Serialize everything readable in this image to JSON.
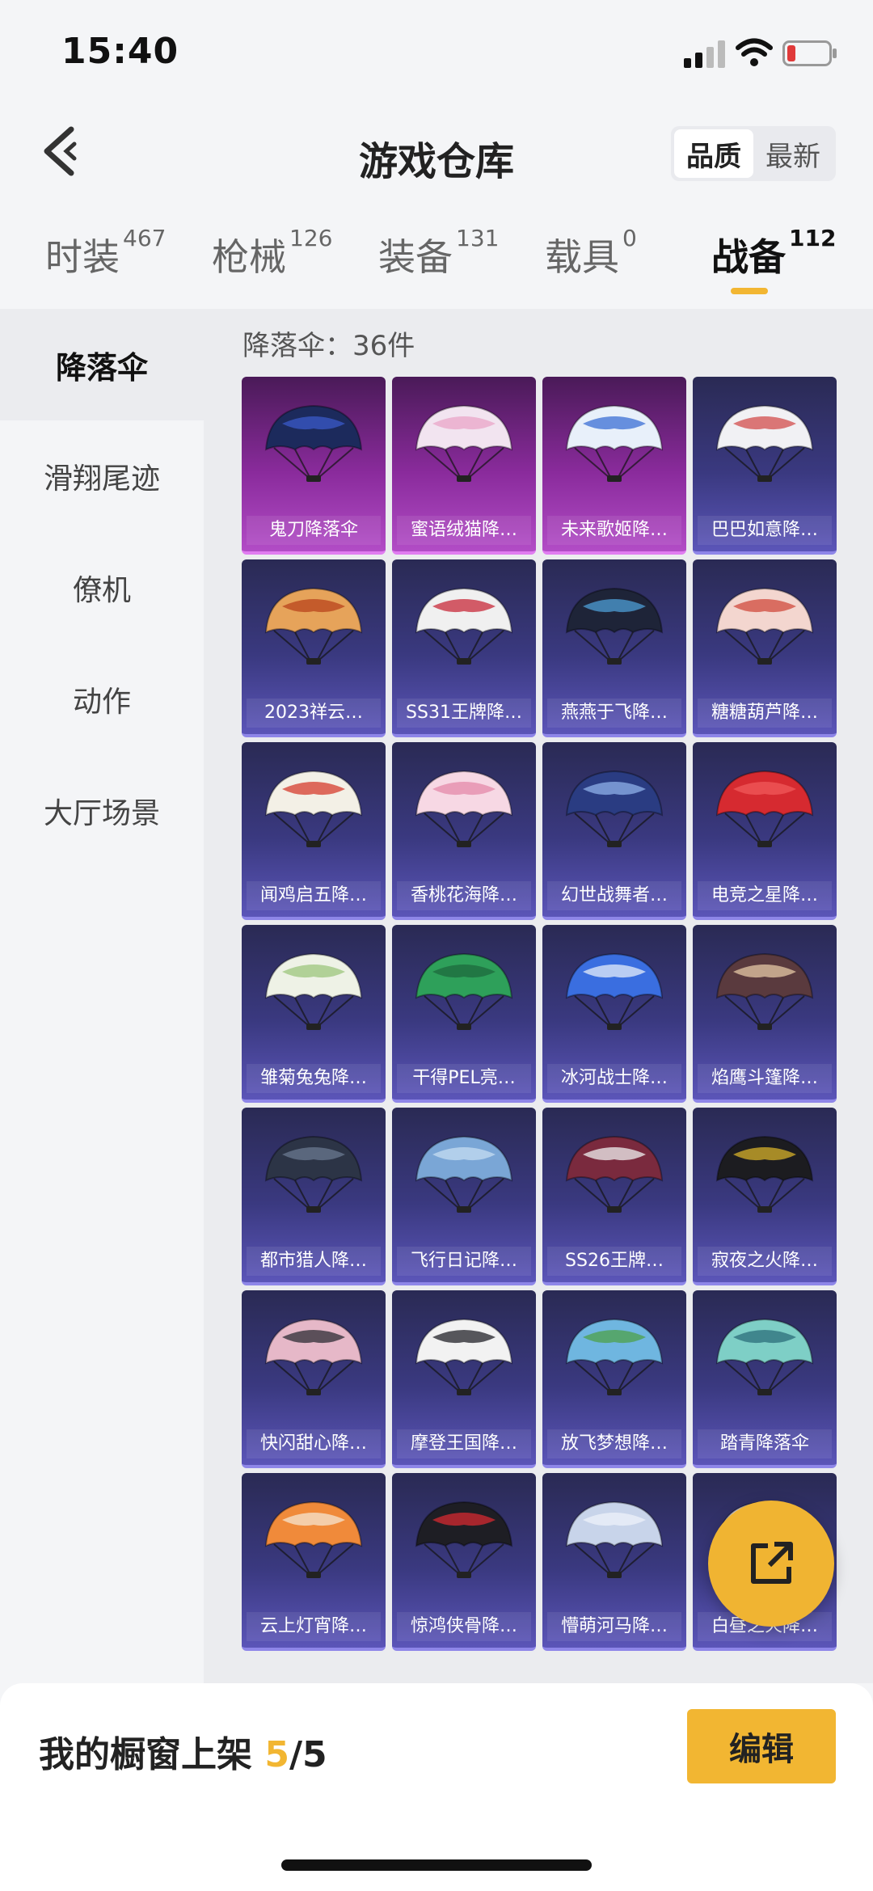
{
  "status_bar": {
    "time": "15:40"
  },
  "header": {
    "title": "游戏仓库",
    "sort_quality": "品质",
    "sort_newest": "最新"
  },
  "tabs": [
    {
      "label": "时装",
      "count": "467"
    },
    {
      "label": "枪械",
      "count": "126"
    },
    {
      "label": "装备",
      "count": "131"
    },
    {
      "label": "载具",
      "count": "0"
    },
    {
      "label": "战备",
      "count": "112"
    }
  ],
  "sidebar": [
    {
      "label": "降落伞"
    },
    {
      "label": "滑翔尾迹"
    },
    {
      "label": "僚机"
    },
    {
      "label": "动作"
    },
    {
      "label": "大厅场景"
    }
  ],
  "content": {
    "count_label": "降落伞：36件"
  },
  "items": [
    {
      "name": "鬼刀降落伞",
      "rarity": "purple",
      "colors": [
        "#1c2a5c",
        "#3a5ac8"
      ]
    },
    {
      "name": "蜜语绒猫降…",
      "rarity": "purple",
      "colors": [
        "#f2e4f0",
        "#e9a6c8"
      ]
    },
    {
      "name": "未来歌姬降…",
      "rarity": "purple",
      "colors": [
        "#e8f0fa",
        "#3b6fd4"
      ]
    },
    {
      "name": "巴巴如意降…",
      "rarity": "blue",
      "colors": [
        "#f1f1f4",
        "#d14c4c"
      ]
    },
    {
      "name": "2023祥云…",
      "rarity": "blue",
      "colors": [
        "#e6a35a",
        "#b8431c"
      ]
    },
    {
      "name": "SS31王牌降…",
      "rarity": "blue",
      "colors": [
        "#f0f0f0",
        "#c82a3a"
      ]
    },
    {
      "name": "燕燕于飞降…",
      "rarity": "blue",
      "colors": [
        "#1e2438",
        "#4e9ed6"
      ]
    },
    {
      "name": "糖糖葫芦降…",
      "rarity": "blue",
      "colors": [
        "#f3d6cf",
        "#d04a3c"
      ]
    },
    {
      "name": "闻鸡启五降…",
      "rarity": "blue",
      "colors": [
        "#f3f0e6",
        "#d63c2c"
      ]
    },
    {
      "name": "香桃花海降…",
      "rarity": "blue",
      "colors": [
        "#f7d8e4",
        "#e48aaa"
      ]
    },
    {
      "name": "幻世战舞者…",
      "rarity": "blue",
      "colors": [
        "#2a3c82",
        "#8fb0e8"
      ]
    },
    {
      "name": "电竞之星降…",
      "rarity": "blue",
      "colors": [
        "#d62a30",
        "#f05a5a"
      ]
    },
    {
      "name": "雏菊兔兔降…",
      "rarity": "blue",
      "colors": [
        "#eef2e6",
        "#9cc57c"
      ]
    },
    {
      "name": "干得PEL亮…",
      "rarity": "blue",
      "colors": [
        "#2ea05a",
        "#1e6a3e"
      ]
    },
    {
      "name": "冰河战士降…",
      "rarity": "blue",
      "colors": [
        "#3a6ee0",
        "#e6eefa"
      ]
    },
    {
      "name": "焰鹰斗篷降…",
      "rarity": "blue",
      "colors": [
        "#5a3a3e",
        "#e6c8a6"
      ]
    },
    {
      "name": "都市猎人降…",
      "rarity": "blue",
      "colors": [
        "#2c3446",
        "#6a7890"
      ]
    },
    {
      "name": "飞行日记降…",
      "rarity": "blue",
      "colors": [
        "#7aa6d6",
        "#c6dcf2"
      ]
    },
    {
      "name": "SS26王牌…",
      "rarity": "blue",
      "colors": [
        "#7a2a3e",
        "#f0f0f0"
      ]
    },
    {
      "name": "寂夜之火降…",
      "rarity": "blue",
      "colors": [
        "#1c1c20",
        "#d6b02a"
      ]
    },
    {
      "name": "快闪甜心降…",
      "rarity": "blue",
      "colors": [
        "#e6b8c8",
        "#2c2c34"
      ]
    },
    {
      "name": "摩登王国降…",
      "rarity": "blue",
      "colors": [
        "#f2f2f2",
        "#222228"
      ]
    },
    {
      "name": "放飞梦想降…",
      "rarity": "blue",
      "colors": [
        "#6fb6e0",
        "#4ea04a"
      ]
    },
    {
      "name": "踏青降落伞",
      "rarity": "blue",
      "colors": [
        "#7ecfc6",
        "#2c6e7a"
      ]
    },
    {
      "name": "云上灯宵降…",
      "rarity": "blue",
      "colors": [
        "#f08a3a",
        "#f6e4d0"
      ]
    },
    {
      "name": "惊鸿侠骨降…",
      "rarity": "blue",
      "colors": [
        "#1e1e24",
        "#d62a30"
      ]
    },
    {
      "name": "懵萌河马降…",
      "rarity": "blue",
      "colors": [
        "#c8d4ea",
        "#eef2fa"
      ]
    },
    {
      "name": "白昼之火降…",
      "rarity": "blue",
      "colors": [
        "#e8e6f0",
        "#9a98c8"
      ]
    }
  ],
  "bottom": {
    "showcase_prefix": "我的橱窗上架 ",
    "showcase_count": "5",
    "showcase_total": "/5",
    "edit_label": "编辑"
  },
  "colors": {
    "accent": "#f2b632",
    "legendary": "#b24cc6",
    "epic": "#5b55b8"
  }
}
